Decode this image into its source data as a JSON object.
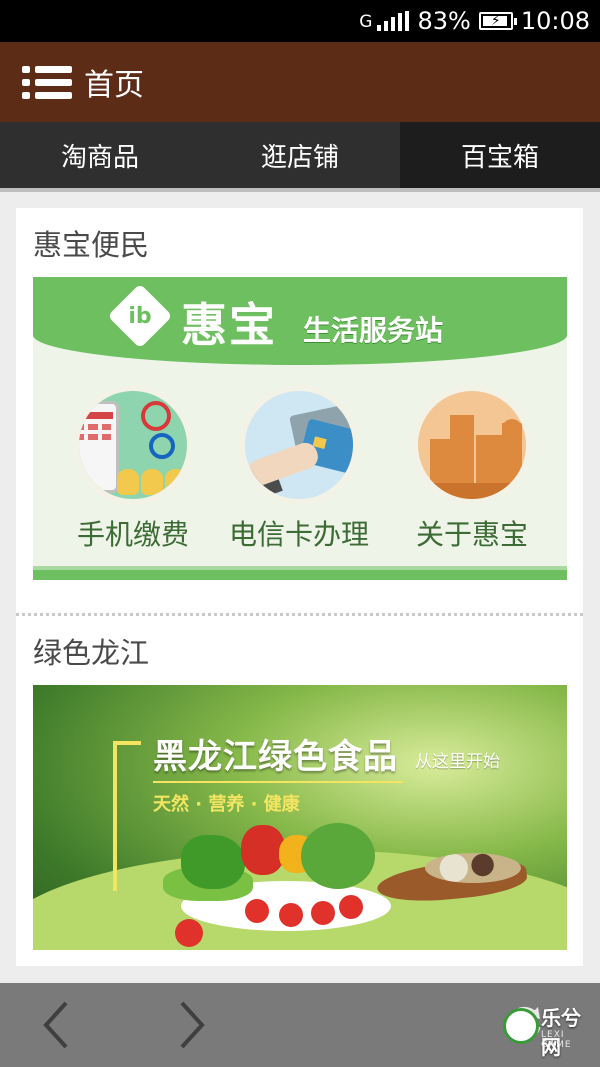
{
  "status_bar": {
    "signal_label": "G",
    "battery_percent": "83%",
    "battery_level": 0.83,
    "time": "10:08"
  },
  "header": {
    "title": "首页",
    "background": "#5d2c17"
  },
  "tabs": [
    {
      "label": "淘商品",
      "active": false
    },
    {
      "label": "逛店铺",
      "active": false
    },
    {
      "label": "百宝箱",
      "active": true
    }
  ],
  "sections": {
    "s1": {
      "title": "惠宝便民",
      "banner": {
        "brand": "惠宝",
        "subtitle": "生活服务站",
        "services": [
          "手机缴费",
          "电信卡办理",
          "关于惠宝"
        ]
      }
    },
    "s2": {
      "title": "绿色龙江",
      "banner": {
        "headline": "黑龙江绿色食品",
        "headline_small": "从这里开始",
        "tagline": "天然 · 营养 · 健康"
      }
    }
  },
  "watermark": {
    "name": "乐兮网",
    "sub": "LEXI GAME"
  },
  "colors": {
    "accent_green": "#6dbf5f",
    "tab_bar": "#2f2f2f",
    "bottom_bar": "#7a7a7a"
  }
}
